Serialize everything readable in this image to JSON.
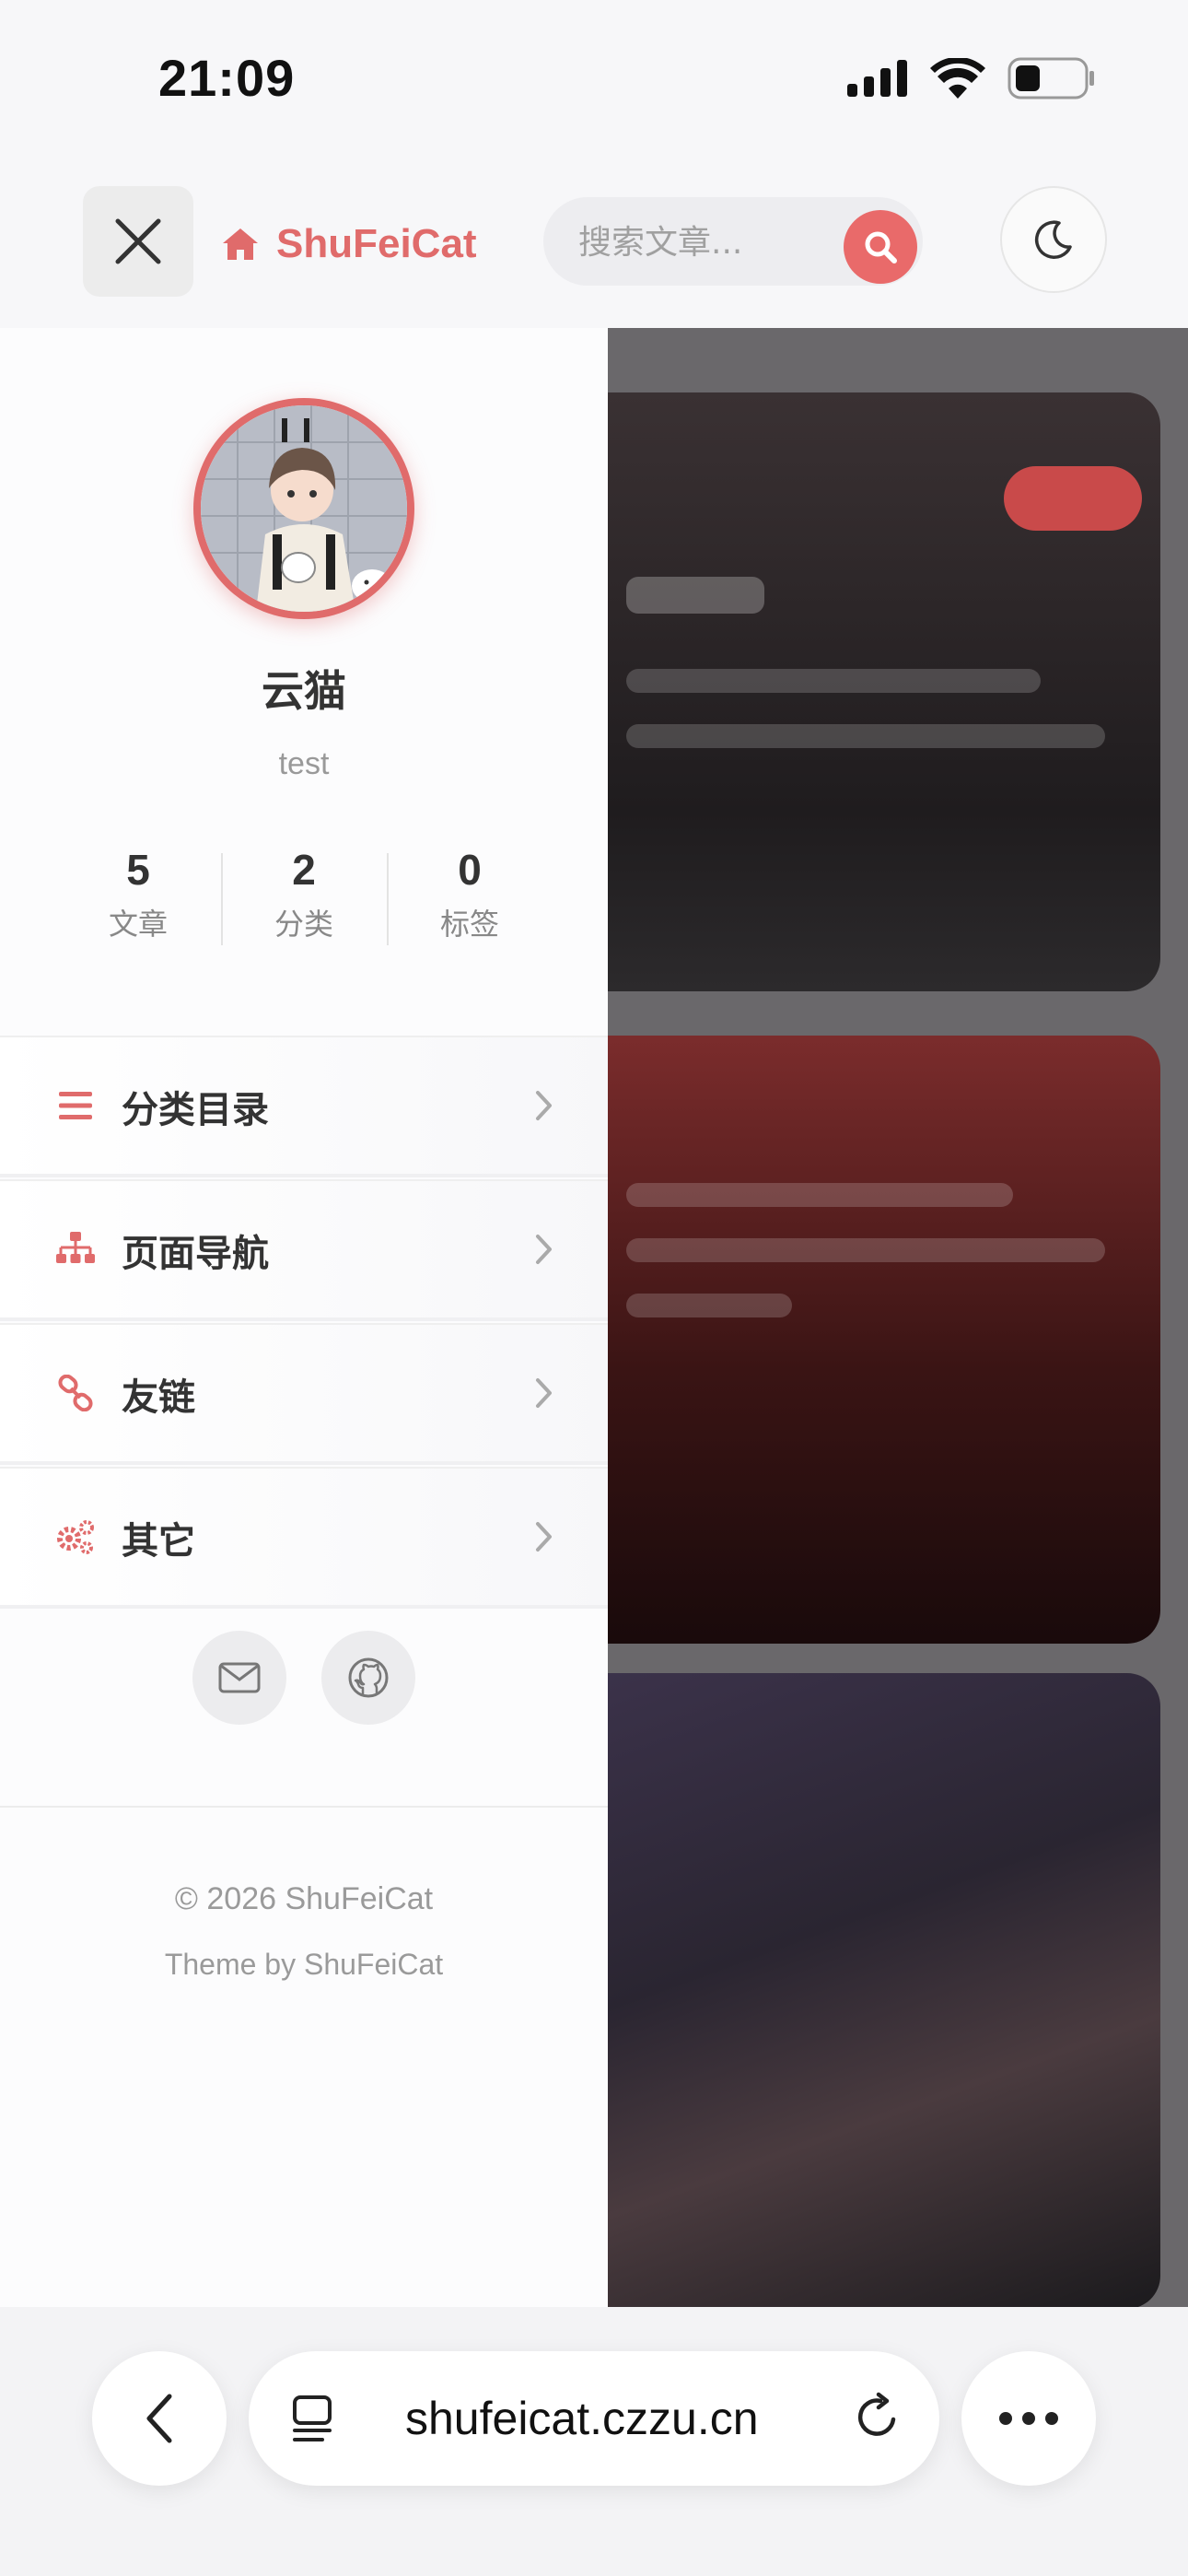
{
  "status_bar": {
    "time": "21:09"
  },
  "header": {
    "brand_name": "ShuFeiCat",
    "search_placeholder": "搜索文章..."
  },
  "profile": {
    "name": "云猫",
    "bio": "test",
    "stats": [
      {
        "value": "5",
        "label": "文章"
      },
      {
        "value": "2",
        "label": "分类"
      },
      {
        "value": "0",
        "label": "标签"
      }
    ]
  },
  "menu": {
    "items": [
      {
        "label": "分类目录",
        "icon": "list-icon"
      },
      {
        "label": "页面导航",
        "icon": "sitemap-icon"
      },
      {
        "label": "友链",
        "icon": "link-icon"
      },
      {
        "label": "其它",
        "icon": "cogs-icon"
      }
    ]
  },
  "social": {
    "icons": [
      "mail-icon",
      "github-icon"
    ]
  },
  "footer": {
    "copyright": "© 2026 ShuFeiCat",
    "theme_credit": "Theme by ShuFeiCat"
  },
  "browser": {
    "url": "shufeicat.czzu.cn"
  },
  "colors": {
    "accent": "#e06b6b",
    "background": "#f7f7f9"
  }
}
